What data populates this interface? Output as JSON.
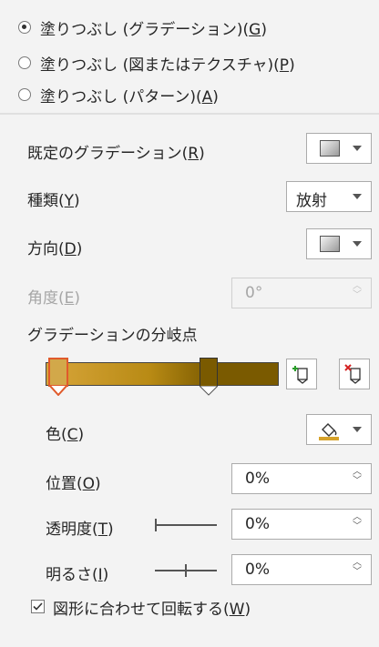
{
  "fill_options": [
    {
      "label": "塗りつぶし (グラデーション)(",
      "key": "G",
      "checked": true
    },
    {
      "label": "塗りつぶし (図またはテクスチャ)(",
      "key": "P",
      "checked": false
    },
    {
      "label": "塗りつぶし (パターン)(",
      "key": "A",
      "checked": false
    }
  ],
  "preset_gradient": {
    "label": "既定のグラデーション(",
    "key": "R"
  },
  "type": {
    "label": "種類(",
    "key": "Y",
    "value": "放射"
  },
  "direction": {
    "label": "方向(",
    "key": "D"
  },
  "angle": {
    "label": "角度(",
    "key": "E",
    "value": "0°"
  },
  "gradient_stops": {
    "label": "グラデーションの分岐点",
    "stops": [
      0.0,
      0.72
    ],
    "colors": {
      "start": "#d7a53a",
      "end": "#7a5a00"
    }
  },
  "color": {
    "label": "色(",
    "key": "C",
    "accent": "#d6a22a"
  },
  "position": {
    "label": "位置(",
    "key": "O",
    "value": "0%"
  },
  "transparency": {
    "label": "透明度(",
    "key": "T",
    "value": "0%",
    "level": 0.0
  },
  "brightness": {
    "label": "明るさ(",
    "key": "I",
    "value": "0%",
    "level": 0.5
  },
  "rotate_with_shape": {
    "label": "図形に合わせて回転する(",
    "key": "W",
    "checked": true
  }
}
